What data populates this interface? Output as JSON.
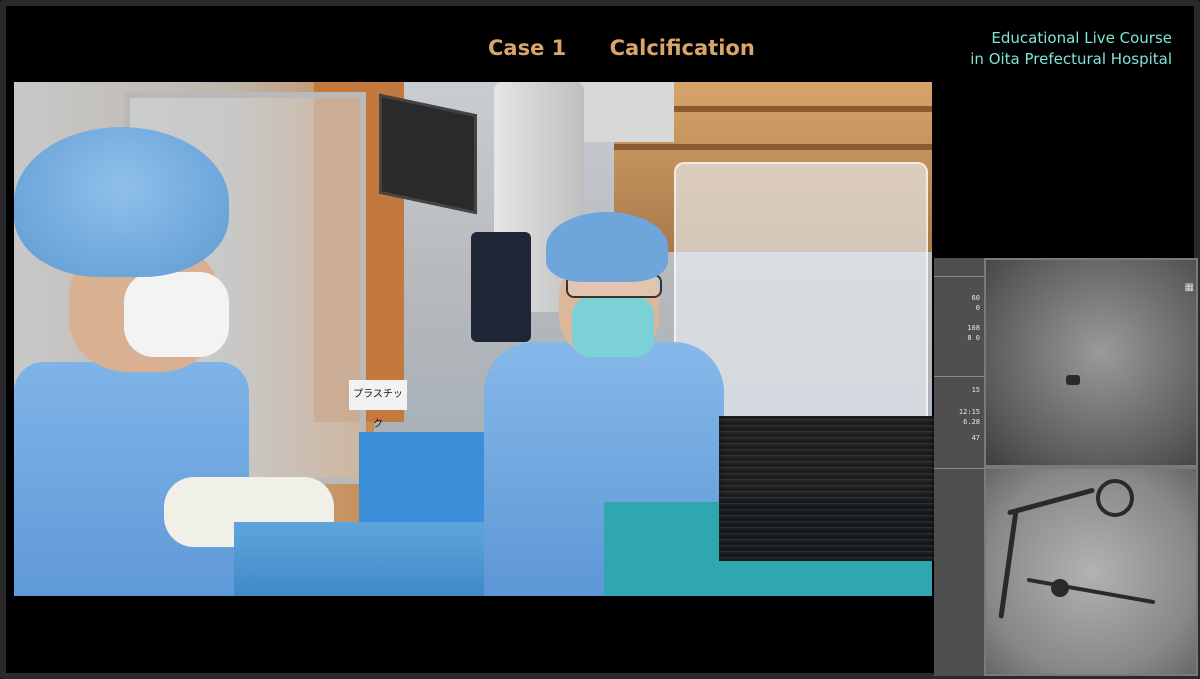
{
  "overlay": {
    "case_label": "Case 1",
    "case_topic": "Calcification",
    "course_line1": "Educational Live Course",
    "course_line2": "in Oita Prefectural Hospital"
  },
  "scene": {
    "sign_text": "プラスチック"
  },
  "angio_panel": {
    "vitals": [
      {
        "value": "60"
      },
      {
        "value": "0"
      },
      {
        "value": "108"
      },
      {
        "value": "8 0"
      },
      {
        "value": "15"
      },
      {
        "value": "12:15"
      },
      {
        "value": "6.28"
      },
      {
        "value": "47"
      }
    ],
    "grid_icon": "grid-icon"
  },
  "colors": {
    "case_title": "#d9a56a",
    "course_text": "#7fe6d6",
    "background": "#000000"
  }
}
